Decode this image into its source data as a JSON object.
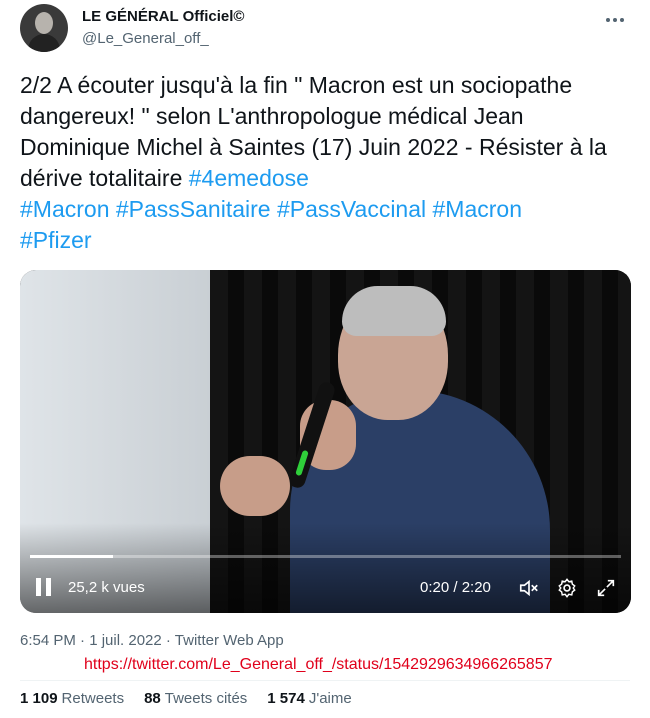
{
  "author": {
    "display_name": "LE GÉNÉRAL Officiel©",
    "handle": "@Le_General_off_",
    "avatar_icon": "user-avatar"
  },
  "tweet": {
    "text_plain": "2/2 A écouter jusqu'à la fin \" Macron est un sociopathe dangereux! \" selon L'anthropologue médical Jean Dominique Michel à Saintes (17) Juin 2022 - Résister à la dérive totalitaire ",
    "hashtags": [
      "#4emedose",
      "#Macron",
      "#PassSanitaire",
      "#PassVaccinal",
      "#Macron",
      "#Pfizer"
    ]
  },
  "video": {
    "views": "25,2 k vues",
    "time": "0:20 / 2:20",
    "progress": 0.14,
    "controls": [
      "pause-icon",
      "mute-icon",
      "settings-gear-icon",
      "fullscreen-icon"
    ]
  },
  "meta": {
    "line": "6:54 PM · 1 juil. 2022 · Twitter Web App",
    "url": "https://twitter.com/Le_General_off_/status/1542929634966265857"
  },
  "stats": [
    {
      "count": "1 109",
      "label": "Retweets"
    },
    {
      "count": "88",
      "label": "Tweets cités"
    },
    {
      "count": "1 574",
      "label": "J'aime"
    }
  ],
  "colors": {
    "link": "#1d9bf0",
    "text": "#0f1419",
    "muted": "#536471",
    "url_red": "#e0001b"
  }
}
